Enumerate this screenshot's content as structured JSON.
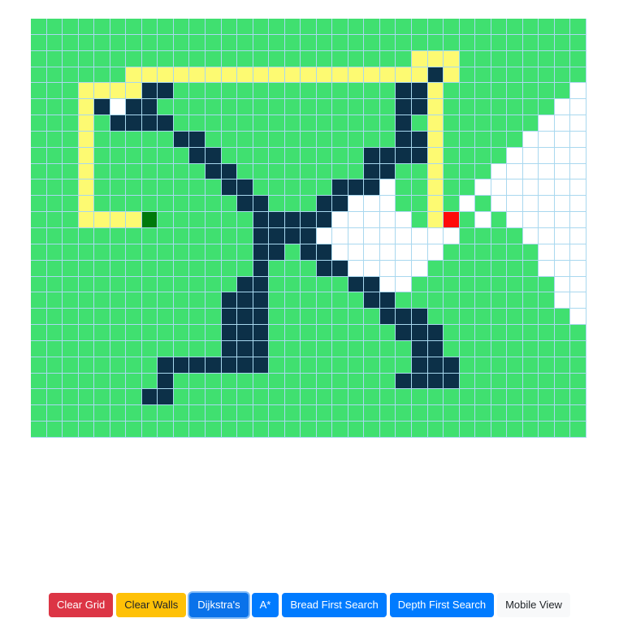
{
  "grid": {
    "cols": 35,
    "rows": 26,
    "legend": {
      ".": "unvisited",
      "W": "wall",
      "V": "visited",
      "P": "shortest-path",
      "S": "start-node",
      "E": "end-node"
    },
    "cells": [
      "...................................",
      "...................................",
      "........................PPP........",
      "......PPPPPPPPPPPPPPPPPPPWP........",
      "...PPPPWW..............WWP........V",
      "...PWVWW...............WWP.......VV",
      "...P.WWWW..............W.P......VVV",
      "...P.....WW............WWP.....VVVV",
      "...P......WW.........WWWWP....VVVVV",
      "...P.......WW........WW..P...VVVVVV",
      "...P........WW.....WWWV..P..VVVVVVV",
      "...P.........WW...WWVVV..P.V.VVVVVV",
      "...PPPPS......WWWWWVVVVV.PE.V.VVVVV",
      "..............WWWWVVVVVVVVV....VVVV",
      "..............WW.WWVVVVVVV......VVV",
      "..............W...WWVVVVV.......VVV",
      ".............WW.....WWVV.........VV",
      "............WWW......WW..........VV",
      "............WWW.......WWW.........V",
      "............WWW........WWW.........",
      "............WWW.........WW.........",
      "........WWWWWWW.........WWW........",
      "........W..............WWWW........",
      ".......WW..........................",
      "...................................",
      "..................................."
    ]
  },
  "toolbar": {
    "clear_grid": "Clear Grid",
    "clear_walls": "Clear Walls",
    "dijkstra": "Dijkstra's",
    "astar": "A*",
    "bfs": "Bread First Search",
    "dfs": "Depth First Search",
    "mobile_view": "Mobile View"
  },
  "colors": {
    "unvisited": "#40e070",
    "wall": "#0c3048",
    "visited": "#ffffff",
    "path": "#fdfa72",
    "start": "#00790b",
    "end": "#ff0a0a",
    "grid_line": "#a9d8ef"
  }
}
